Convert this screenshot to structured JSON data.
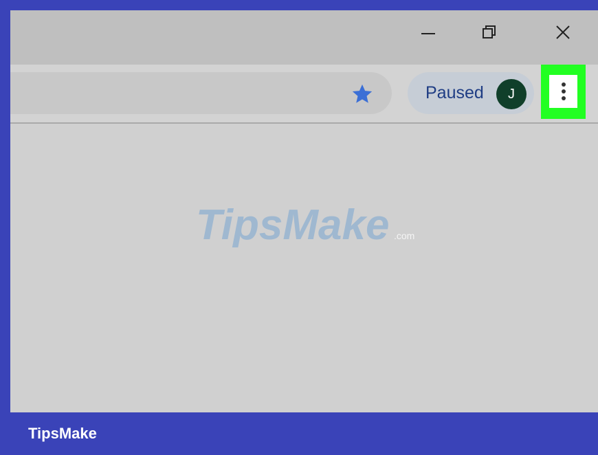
{
  "window": {
    "minimize_icon": "minimize-icon",
    "restore_icon": "restore-icon",
    "close_icon": "close-icon"
  },
  "toolbar": {
    "bookmark_icon": "star-icon",
    "profile": {
      "label": "Paused",
      "avatar_initial": "J"
    },
    "menu_icon": "more-vertical-icon",
    "menu_highlight_color": "#22ff22"
  },
  "colors": {
    "frame": "#3a43b8",
    "star": "#3b6fd6",
    "avatar": "#103f2a",
    "profile_text": "#1f3d84"
  },
  "watermark": {
    "brand_main": "TipsMake",
    "brand_suffix": ".com"
  },
  "footer": {
    "brand": "TipsMake"
  }
}
